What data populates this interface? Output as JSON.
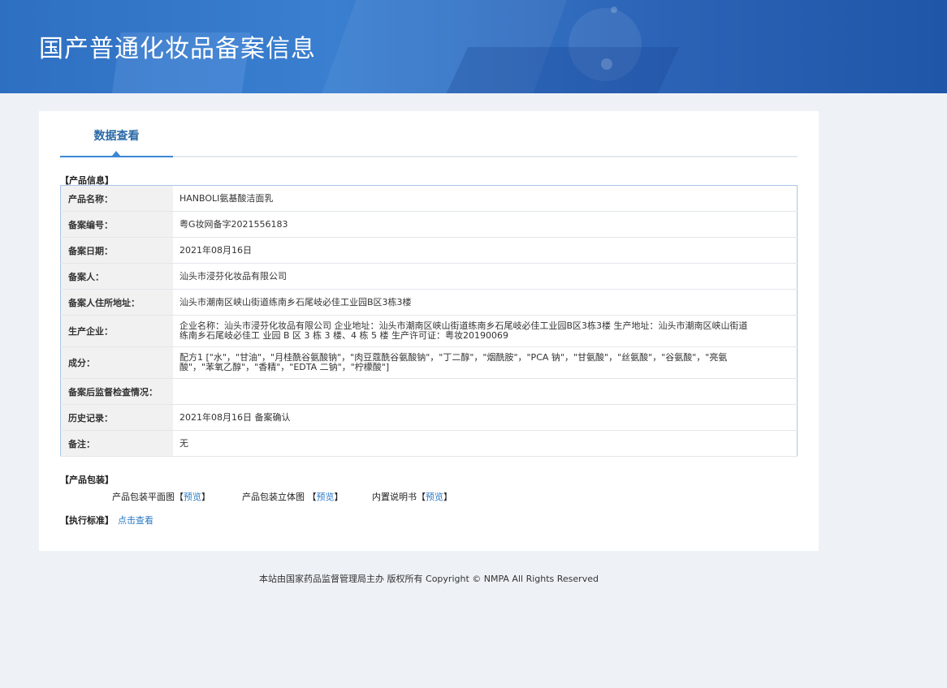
{
  "header": {
    "title": "国产普通化妆品备案信息"
  },
  "tabs": [
    {
      "label": "数据查看",
      "active": true
    }
  ],
  "product_info": {
    "section_label": "【产品信息】",
    "rows": [
      {
        "label": "产品名称：",
        "value": "HANBOLI氨基酸洁面乳"
      },
      {
        "label": "备案编号：",
        "value": "粤G妆网备字2021556183"
      },
      {
        "label": "备案日期：",
        "value": "2021年08月16日"
      },
      {
        "label": "备案人：",
        "value": "汕头市浸芬化妆品有限公司"
      },
      {
        "label": "备案人住所地址：",
        "value": "汕头市潮南区峡山街道练南乡石尾岐必佳工业园B区3栋3楼"
      },
      {
        "label": "生产企业：",
        "value": "企业名称：汕头市浸芬化妆品有限公司 企业地址：汕头市潮南区峡山街道练南乡石尾岐必佳工业园B区3栋3楼 生产地址：汕头市潮南区峡山街道练南乡石尾岐必佳工 业园 B 区 3 栋 3 楼、4 栋 5 楼 生产许可证：粤妆20190069"
      },
      {
        "label": "成分：",
        "value": "配方1 [\"水\"，\"甘油\"，\"月桂酰谷氨酸钠\"，\"肉豆蔻酰谷氨酸钠\"，\"丁二醇\"，\"烟酰胺\"，\"PCA 钠\"，\"甘氨酸\"，\"丝氨酸\"，\"谷氨酸\"，\"亮氨酸\"，\"苯氧乙醇\"，\"香精\"，\"EDTA 二钠\"，\"柠檬酸\"]"
      },
      {
        "label": "备案后监督检查情况：",
        "value": ""
      },
      {
        "label": "历史记录：",
        "value": "2021年08月16日 备案确认"
      },
      {
        "label": "备注：",
        "value": "无"
      }
    ]
  },
  "packaging": {
    "section_label": "【产品包装】",
    "items": [
      {
        "label": "产品包装平面图",
        "link_open": "【",
        "link": "预览",
        "link_close": "】"
      },
      {
        "label": "产品包装立体图 ",
        "link_open": "【",
        "link": "预览",
        "link_close": "】"
      },
      {
        "label": "内置说明书",
        "link_open": "【",
        "link": "预览",
        "link_close": "】"
      }
    ]
  },
  "standard": {
    "section_label": "【执行标准】",
    "link": "点击查看"
  },
  "footer": {
    "text": "本站由国家药品监督管理局主办 版权所有 Copyright © NMPA All Rights Reserved"
  }
}
